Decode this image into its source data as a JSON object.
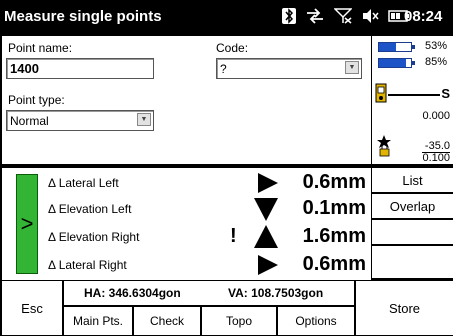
{
  "title_bar": {
    "title": "Measure single points",
    "time": "08:24",
    "status_icons": [
      "bluetooth-icon",
      "network-icon",
      "signal-off-icon",
      "volume-icon",
      "battery-icon"
    ]
  },
  "form": {
    "point_name_label": "Point name:",
    "point_name_value": "1400",
    "code_label": "Code:",
    "code_value": "?",
    "point_type_label": "Point type:",
    "point_type_value": "Normal"
  },
  "status_panel": {
    "battery1_pct": "53%",
    "battery1_level": 0.53,
    "battery2_pct": "85%",
    "battery2_level": 0.85,
    "target_label": "S",
    "target_value": "0.000",
    "tilt_value1": "-35.0",
    "tilt_value2": "0.100"
  },
  "deviations": [
    {
      "name": "Δ Lateral Left",
      "arrow": "right",
      "warning": "",
      "value": "0.6mm"
    },
    {
      "name": "Δ Elevation Left",
      "arrow": "down",
      "warning": "",
      "value": "0.1mm"
    },
    {
      "name": "Δ Elevation Right",
      "arrow": "up",
      "warning": "!",
      "value": "1.6mm"
    },
    {
      "name": "Δ Lateral Right",
      "arrow": "right",
      "warning": "",
      "value": "0.6mm"
    }
  ],
  "side_buttons": {
    "list": "List",
    "overlap": "Overlap"
  },
  "bottom": {
    "esc": "Esc",
    "ha": "HA: 346.6304gon",
    "va": "VA: 108.7503gon",
    "tabs": [
      "Main Pts.",
      "Check",
      "Topo",
      "Options"
    ],
    "store": "Store"
  },
  "colors": {
    "accent_green": "#34b434",
    "battery_blue": "#1c54c8",
    "lock_yellow": "#e2b400"
  }
}
